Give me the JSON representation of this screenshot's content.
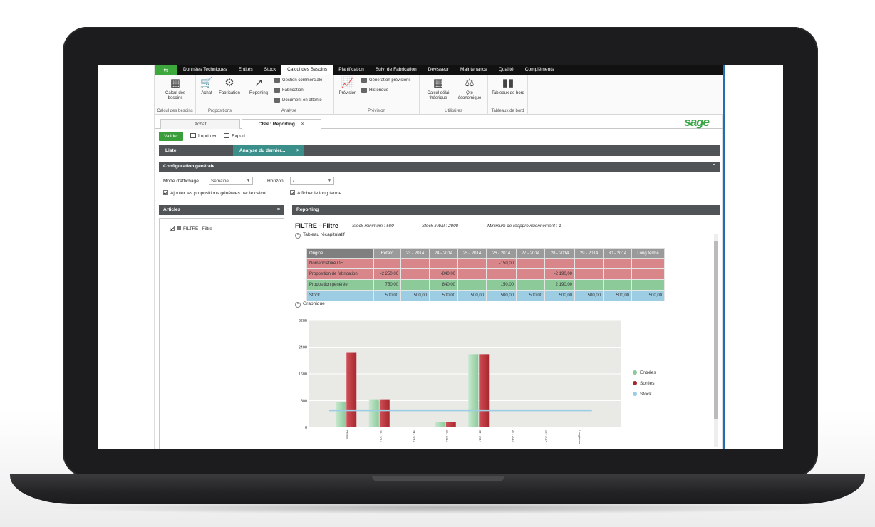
{
  "menu": {
    "tabs": [
      "Données Techniques",
      "Entités",
      "Stock",
      "Calcul des Besoins",
      "Planification",
      "Suivi de Fabrication",
      "Devisseur",
      "Maintenance",
      "Qualité",
      "Compléments"
    ],
    "active_index": 3
  },
  "ribbon": {
    "calcul_besoins": {
      "button": "Calcul des besoins",
      "group": "Calcul des besoins"
    },
    "propositions": {
      "achat": "Achat",
      "fabrication": "Fabrication",
      "group": "Propositions"
    },
    "analyse": {
      "reporting": "Reporting",
      "gestion_commerciale": "Gestion commerciale",
      "fabrication": "Fabrication",
      "document_attente": "Document en attente",
      "group": "Analyse"
    },
    "prevision": {
      "button": "Prévision",
      "generation": "Génération prévisions",
      "historique": "Historique",
      "group": "Prévision"
    },
    "utilitaires": {
      "calcul_delai": "Calcul délai théorique",
      "qte_economique": "Qté économique",
      "group": "Utilitaires"
    },
    "tableaux": {
      "button": "Tableaux de bord",
      "group": "Tableaux de bord"
    }
  },
  "doc_tabs": {
    "achat": "Achat",
    "reporting": "CBN : Reporting"
  },
  "brand": "sage",
  "toolbar": {
    "valider": "Valider",
    "imprimer": "Imprimer",
    "export": "Export"
  },
  "subtabs": {
    "liste": "Liste",
    "analyse": "Analyse du dernier..."
  },
  "config": {
    "title": "Configuration générale",
    "mode_label": "Mode d'affichage",
    "mode_value": "Semaine",
    "horizon_label": "Horizon",
    "horizon_value": "7",
    "ajouter_label": "Ajouter les propositions générées par le calcul",
    "long_terme_label": "Afficher le long terme"
  },
  "articles": {
    "title": "Articles",
    "item": "FILTRE - Filtre"
  },
  "reporting": {
    "title": "Reporting",
    "article": "FILTRE - Filtre",
    "stock_min": "Stock minimum : 500",
    "stock_initial": "Stock initial : 2000",
    "min_reappro": "Minimum de réapprovisionnement : 1",
    "tableau_label": "Tableau récapitulatif",
    "graphique_label": "Graphique",
    "table": {
      "headers": [
        "Origine",
        "Retard",
        "23 - 2014",
        "24 - 2014",
        "25 - 2014",
        "26 - 2014",
        "27 - 2014",
        "28 - 2014",
        "29 - 2014",
        "30 - 2014",
        "Long terme"
      ],
      "rows": [
        {
          "label": "Nomenclature OF",
          "values": [
            "",
            "",
            "",
            "",
            "-150,00",
            "",
            "",
            "",
            "",
            ""
          ]
        },
        {
          "label": "Proposition de fabrication",
          "values": [
            "-2 250,00",
            "",
            "-840,00",
            "",
            "",
            "",
            "-2 190,00",
            "",
            "",
            ""
          ]
        },
        {
          "label": "Proposition générée",
          "values": [
            "750,00",
            "",
            "840,00",
            "",
            "150,00",
            "",
            "2 190,00",
            "",
            "",
            ""
          ]
        },
        {
          "label": "Stock",
          "values": [
            "500,00",
            "500,00",
            "500,00",
            "500,00",
            "500,00",
            "500,00",
            "500,00",
            "500,00",
            "500,00",
            "500,00"
          ]
        }
      ]
    }
  },
  "chart_data": {
    "type": "bar",
    "categories": [
      "Retard",
      "23 - 2014",
      "24 - 2014",
      "25 - 2014",
      "26 - 2014",
      "27 - 2014",
      "28 - 2014",
      "Long terme"
    ],
    "tick_labels": [
      "Retard",
      "23 - 2014",
      "24 - 2014",
      "25 - 2014",
      "26 - 2014",
      "27 - 2014",
      "28 - 2014",
      "Long terme"
    ],
    "series": [
      {
        "name": "Entrées",
        "color": "#8cca9a",
        "values": [
          750,
          840,
          0,
          150,
          2190,
          0,
          0,
          0
        ]
      },
      {
        "name": "Sorties",
        "color": "#a8262e",
        "values": [
          2250,
          840,
          0,
          150,
          2190,
          0,
          0,
          0
        ]
      },
      {
        "name": "Stock",
        "color": "#9dcde3",
        "values": [
          500,
          500,
          500,
          500,
          500,
          500,
          500,
          500
        ]
      }
    ],
    "yticks": [
      "0",
      "800",
      "1600",
      "2400",
      "3200"
    ],
    "ylim": [
      0,
      3200
    ],
    "legend_position": "right"
  }
}
